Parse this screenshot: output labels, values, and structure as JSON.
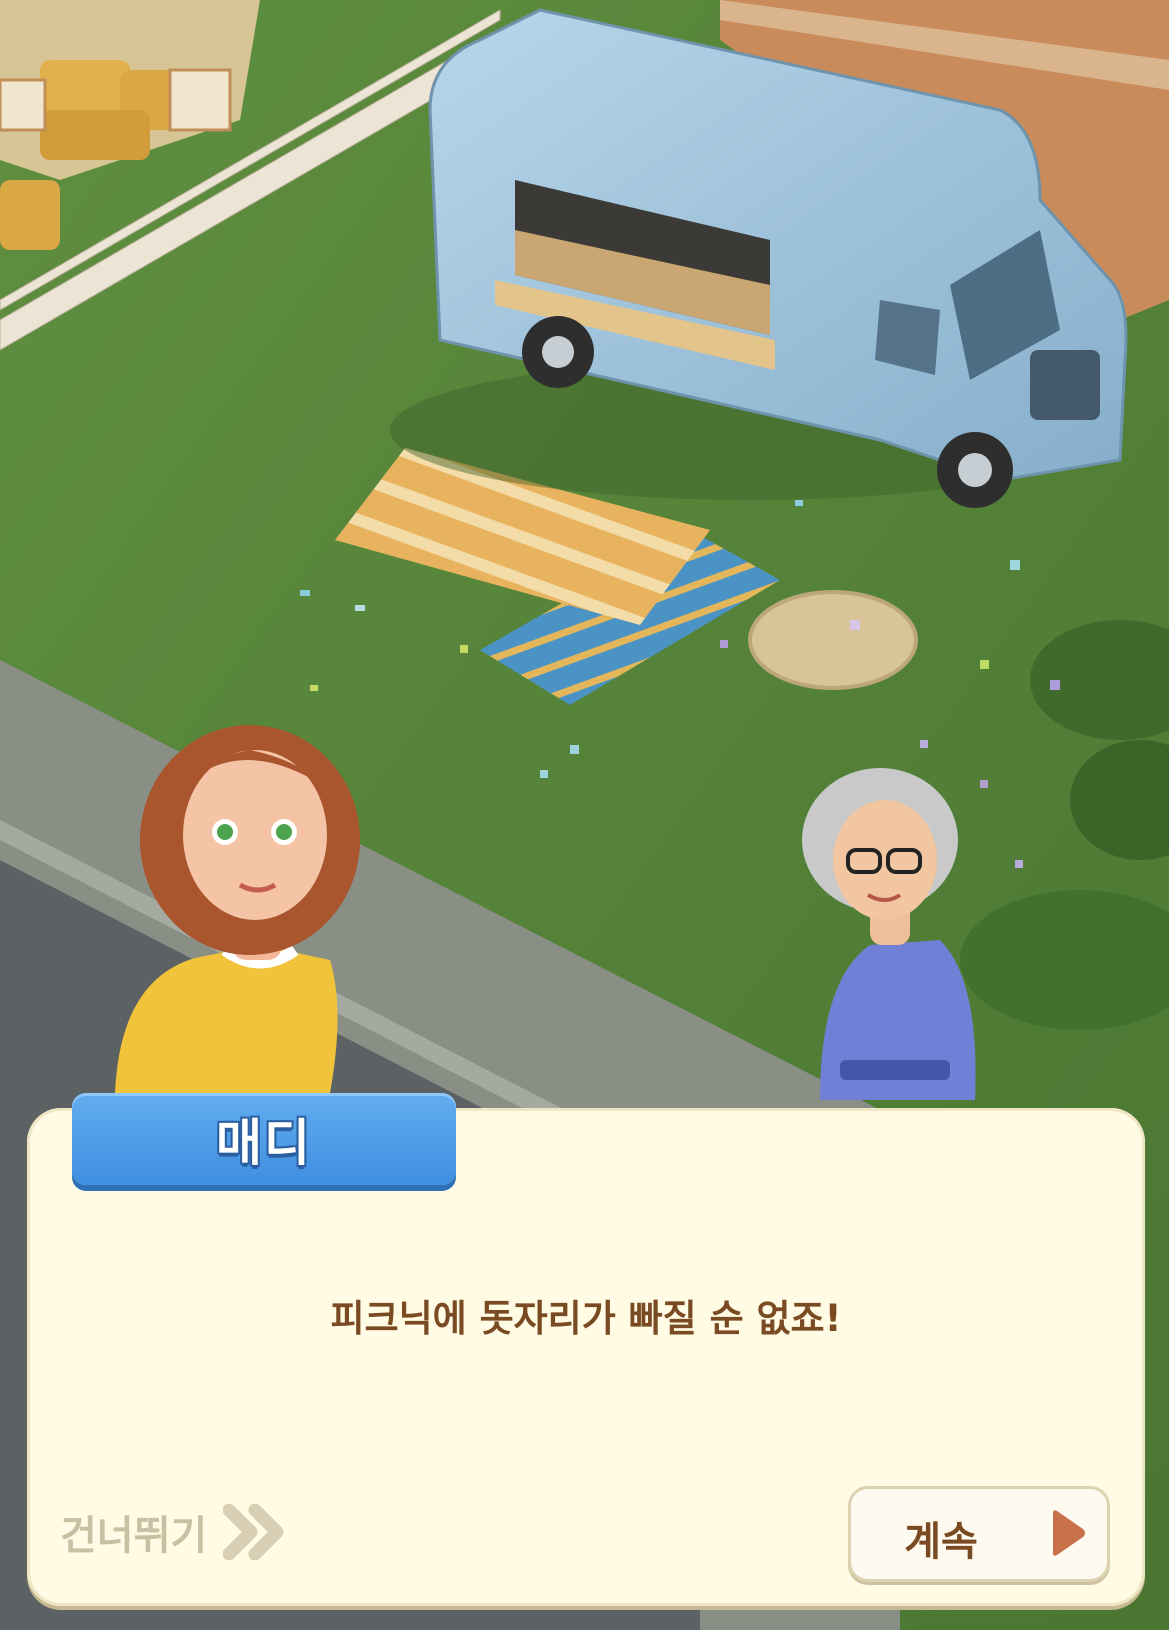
{
  "dialogue": {
    "speaker_name": "매디",
    "line": "피크닉에 돗자리가 빠질 순 없죠!"
  },
  "controls": {
    "skip_label": "건너뛰기",
    "skip_icon": "double-chevron-right-icon",
    "continue_label": "계속",
    "continue_icon": "play-triangle-icon"
  },
  "colors": {
    "name_tab": "#4f9ee8",
    "dialog_bg": "#fffbe4",
    "dialog_text": "#7a4a22",
    "skip_text": "#c9bfa3",
    "continue_arrow": "#c9714a",
    "truck": "#9cc4de",
    "grass": "#5b8a3d"
  }
}
